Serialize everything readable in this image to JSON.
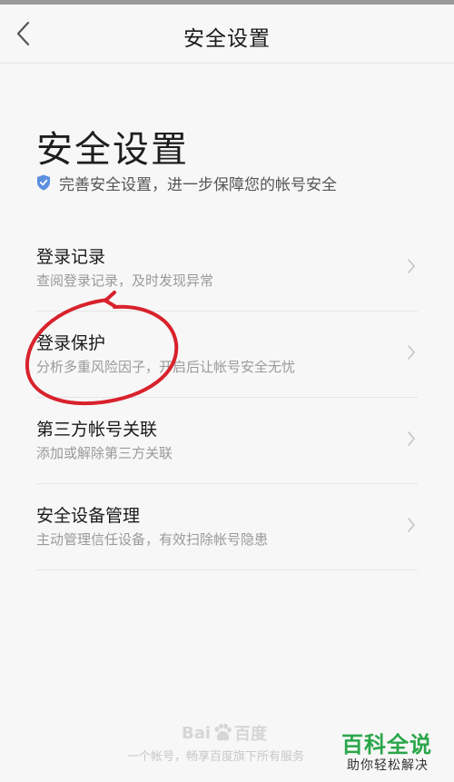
{
  "navbar": {
    "title": "安全设置"
  },
  "header": {
    "title": "安全设置",
    "subtitle": "完善安全设置，进一步保障您的帐号安全"
  },
  "menu": [
    {
      "label": "登录记录",
      "desc": "查阅登录记录，及时发现异常"
    },
    {
      "label": "登录保护",
      "desc": "分析多重风险因子，开启后让帐号安全无忧"
    },
    {
      "label": "第三方帐号关联",
      "desc": "添加或解除第三方关联"
    },
    {
      "label": "安全设备管理",
      "desc": "主动管理信任设备，有效扫除帐号隐患"
    }
  ],
  "footer": {
    "logo_left": "Bai",
    "logo_right": "百度",
    "text": "一个帐号，畅享百度旗下所有服务"
  },
  "watermark": {
    "title": "百科全说",
    "subtitle": "助你轻松解决"
  },
  "colors": {
    "accent": "#5b8fe0",
    "annotation": "#d8222c",
    "watermark": "#2aa64a"
  }
}
